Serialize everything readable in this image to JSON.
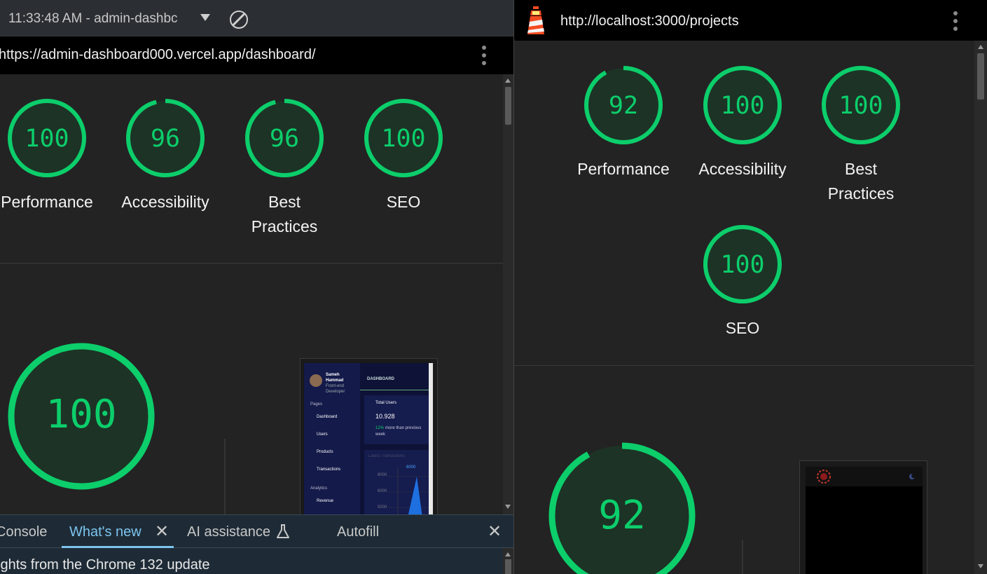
{
  "left": {
    "toolbar": {
      "timestamp_label": "11:33:48 AM - admin-dashbc"
    },
    "url": "https://admin-dashboard000.vercel.app/dashboard/",
    "scores": [
      {
        "value": "100",
        "label": "Performance",
        "score": 100
      },
      {
        "value": "96",
        "label": "Accessibility",
        "score": 96
      },
      {
        "value": "96",
        "label_line1": "Best",
        "label_line2": "Practices",
        "score": 96
      },
      {
        "value": "100",
        "label": "SEO",
        "score": 100
      }
    ],
    "big_score": {
      "value": "100",
      "score": 100
    },
    "screenshot": {
      "user_name_1": "Sameh",
      "user_name_2": "Hammad",
      "user_role_1": "Front-end",
      "user_role_2": "Developer",
      "section_pages": "Pages",
      "nav": [
        "Dashboard",
        "Users",
        "Products",
        "Transactions"
      ],
      "section_analytics": "Analytics",
      "nav_revenue": "Revenue",
      "header": "DASHBOARD",
      "card_title": "Total Users",
      "card_value": "10.928",
      "card_delta": "12%",
      "card_note_1": "more than previous",
      "card_note_2": "week",
      "chart_title": "Latest Transactions",
      "chart_peak": "6000",
      "chart_ticks": [
        "8000",
        "6000",
        "5000"
      ]
    }
  },
  "drawer": {
    "tabs": [
      {
        "label": "Console",
        "active": false
      },
      {
        "label": "What's new",
        "active": true
      },
      {
        "label": "AI assistance",
        "active": false
      },
      {
        "label": "Autofill",
        "active": false
      }
    ],
    "message": "ights from the Chrome 132 update"
  },
  "right": {
    "url": "http://localhost:3000/projects",
    "scores": [
      {
        "value": "92",
        "label": "Performance",
        "score": 92
      },
      {
        "value": "100",
        "label": "Accessibility",
        "score": 100
      },
      {
        "value": "100",
        "label_line1": "Best",
        "label_line2": "Practices",
        "score": 100
      },
      {
        "value": "100",
        "label": "SEO",
        "score": 100
      }
    ],
    "big_score": {
      "value": "92",
      "score": 92
    }
  },
  "colors": {
    "pass_green": "#0cce6b",
    "gauge_fill": "#1d3326",
    "link_blue": "#7cc4f0"
  }
}
